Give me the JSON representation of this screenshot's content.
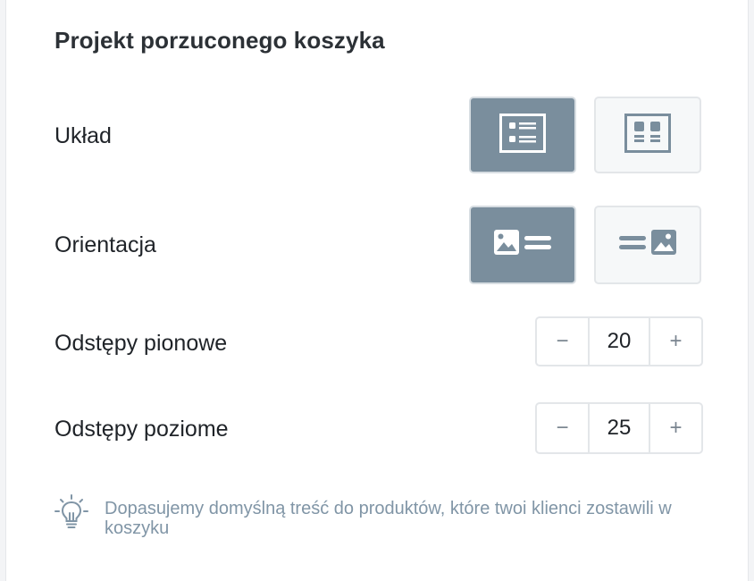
{
  "title": "Projekt porzuconego koszyka",
  "layout": {
    "label": "Układ",
    "options": [
      {
        "icon": "list-layout-icon",
        "selected": true
      },
      {
        "icon": "grid-layout-icon",
        "selected": false
      }
    ]
  },
  "orientation": {
    "label": "Orientacja",
    "options": [
      {
        "icon": "image-left-icon",
        "selected": true
      },
      {
        "icon": "image-right-icon",
        "selected": false
      }
    ]
  },
  "vertical_spacing": {
    "label": "Odstępy pionowe",
    "value": "20",
    "decrement": "−",
    "increment": "+"
  },
  "horizontal_spacing": {
    "label": "Odstępy poziome",
    "value": "25",
    "decrement": "−",
    "increment": "+"
  },
  "hint": {
    "icon": "lightbulb-icon",
    "text": "Dopasujemy domyślną treść do produktów, które twoi klienci zostawili w koszyku"
  },
  "colors": {
    "selected_bg": "#7a8e9d",
    "hint_text": "#8095a6"
  }
}
